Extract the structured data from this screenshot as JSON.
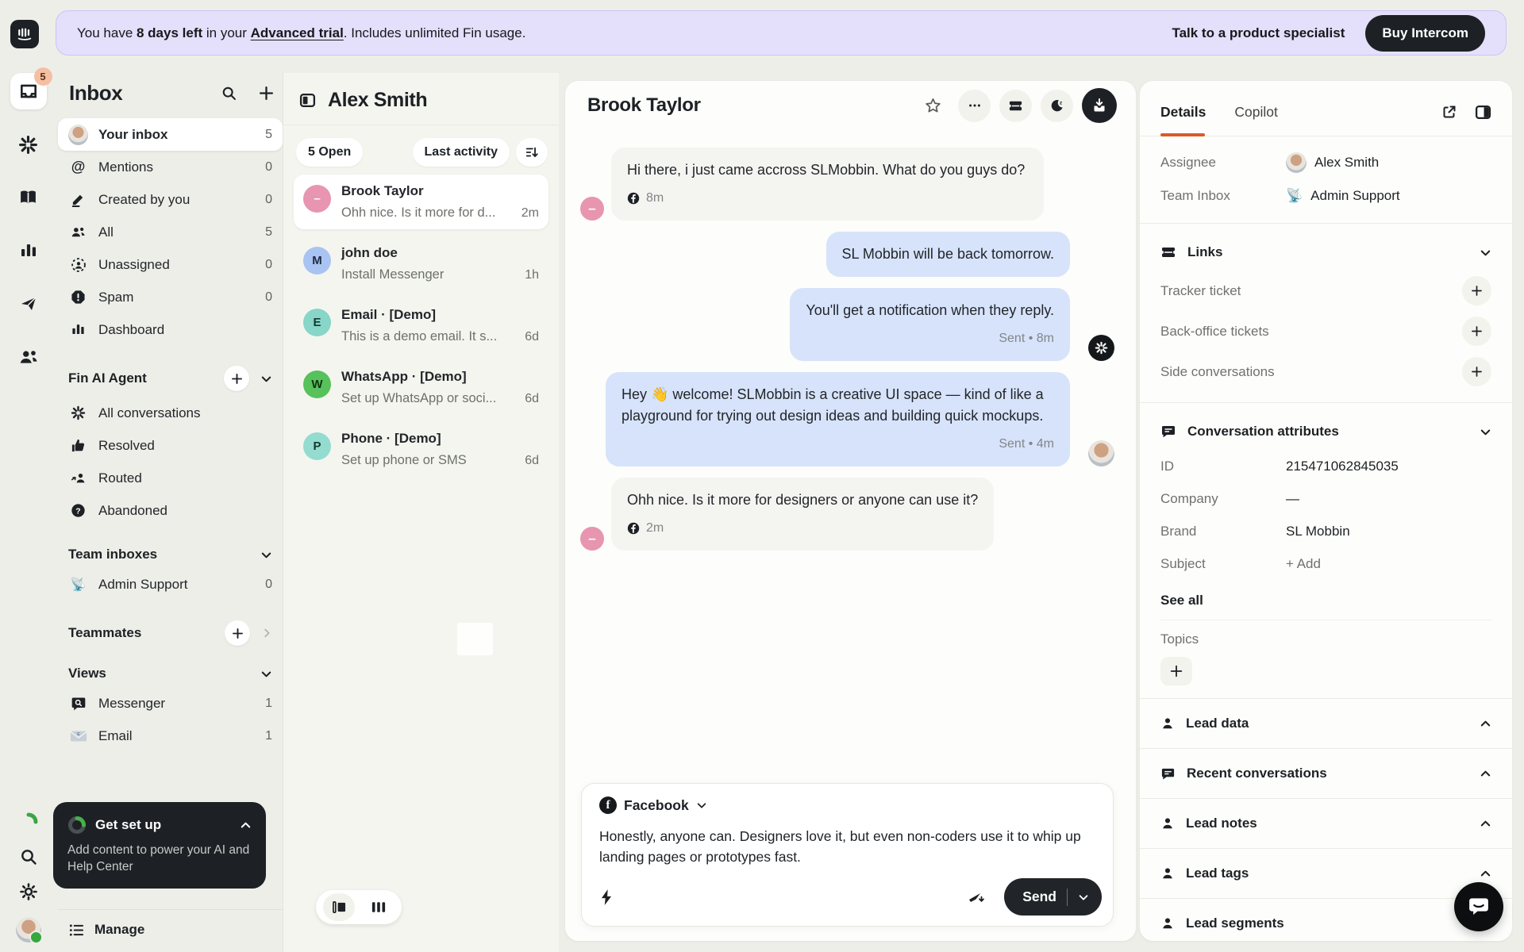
{
  "banner": {
    "message_prefix": "You have ",
    "days_left": "8 days left",
    "message_mid": " in your ",
    "trial_link": "Advanced trial",
    "message_suffix": ". Includes unlimited Fin usage.",
    "specialist_link": "Talk to a product specialist",
    "buy_button": "Buy Intercom"
  },
  "rail": {
    "inbox_badge": "5"
  },
  "sidebar": {
    "title": "Inbox",
    "items": [
      {
        "label": "Your inbox",
        "count": "5"
      },
      {
        "label": "Mentions",
        "count": "0"
      },
      {
        "label": "Created by you",
        "count": "0"
      },
      {
        "label": "All",
        "count": "5"
      },
      {
        "label": "Unassigned",
        "count": "0"
      },
      {
        "label": "Spam",
        "count": "0"
      },
      {
        "label": "Dashboard",
        "count": ""
      }
    ],
    "fin_section": {
      "title": "Fin AI Agent",
      "items": [
        "All conversations",
        "Resolved",
        "Routed",
        "Abandoned"
      ]
    },
    "team_inboxes": {
      "title": "Team inboxes",
      "items": [
        {
          "label": "Admin Support",
          "count": "0"
        }
      ]
    },
    "teammates": {
      "title": "Teammates"
    },
    "views": {
      "title": "Views",
      "items": [
        {
          "label": "Messenger",
          "count": "1"
        },
        {
          "label": "Email",
          "count": "1"
        }
      ]
    },
    "setup_card": {
      "title": "Get set up",
      "description": "Add content to power your AI and Help Center"
    },
    "manage": "Manage"
  },
  "conversation_list": {
    "header": "Alex Smith",
    "open_filter": "5 Open",
    "sort_label": "Last activity",
    "items": [
      {
        "name": "Brook Taylor",
        "preview": "Ohh nice. Is it more for d...",
        "time": "2m",
        "initial": "–"
      },
      {
        "name": "john doe",
        "preview": "Install Messenger",
        "time": "1h",
        "initial": "M"
      },
      {
        "name": "Email · [Demo]",
        "preview": "This is a demo email. It s...",
        "time": "6d",
        "initial": "E"
      },
      {
        "name": "WhatsApp · [Demo]",
        "preview": "Set up WhatsApp or soci...",
        "time": "6d",
        "initial": "W"
      },
      {
        "name": "Phone · [Demo]",
        "preview": "Set up phone or SMS",
        "time": "6d",
        "initial": "P"
      }
    ]
  },
  "chat": {
    "header": "Brook Taylor",
    "messages": [
      {
        "text": "Hi there, i just came accross SLMobbin. What do you guys do?",
        "meta": "8m"
      },
      {
        "text": "SL Mobbin will be back tomorrow.",
        "meta": ""
      },
      {
        "text": "You'll get a notification when they reply.",
        "meta": "Sent • 8m"
      },
      {
        "text": "Hey 👋 welcome! SLMobbin is a creative UI space — kind of like a playground for trying out design ideas and building quick mockups.",
        "meta": "Sent • 4m"
      },
      {
        "text": "Ohh nice. Is it more for designers or anyone can use it?",
        "meta": "2m"
      }
    ]
  },
  "composer": {
    "channel": "Facebook",
    "draft": "Honestly, anyone can. Designers love it, but even non-coders use it to whip up landing pages or prototypes fast.",
    "send_label": "Send"
  },
  "details": {
    "tabs": [
      "Details",
      "Copilot"
    ],
    "assignee_label": "Assignee",
    "assignee": "Alex Smith",
    "team_inbox_label": "Team Inbox",
    "team_inbox": "Admin Support",
    "links": {
      "title": "Links",
      "rows": [
        "Tracker ticket",
        "Back-office tickets",
        "Side conversations"
      ]
    },
    "attributes": {
      "title": "Conversation attributes",
      "rows": [
        {
          "label": "ID",
          "value": "215471062845035"
        },
        {
          "label": "Company",
          "value": "—"
        },
        {
          "label": "Brand",
          "value": "SL Mobbin"
        },
        {
          "label": "Subject",
          "value": "+ Add"
        }
      ],
      "see_all": "See all",
      "topics_label": "Topics"
    },
    "sections": [
      "Lead data",
      "Recent conversations",
      "Lead notes",
      "Lead tags",
      "Lead segments"
    ]
  },
  "colors": {
    "accent_orange": "#d85a2b",
    "banner_lavender": "#e4dffb",
    "bubble_blue": "#d6e3fa",
    "bubble_gray": "#f4f4f1",
    "dark": "#1d2125",
    "badge_salmon": "#f5bfa3"
  },
  "icons": [
    "intercom-logo",
    "inbox-icon",
    "fin-burst-icon",
    "book-icon",
    "report-icon",
    "outbound-icon",
    "contacts-icon",
    "progress-arc-icon",
    "search-icon",
    "gear-icon",
    "mention-icon",
    "pencil-icon",
    "people-icon",
    "unassigned-icon",
    "spam-icon",
    "dashboard-icon",
    "thumbs-up-icon",
    "routed-icon",
    "question-icon",
    "satellite-icon",
    "messenger-icon",
    "email-icon",
    "manage-icon",
    "collapse-panel-icon",
    "sort-icon",
    "star-icon",
    "ellipsis-icon",
    "ticket-icon",
    "snooze-icon",
    "close-conversation-icon",
    "facebook-icon",
    "lightning-icon",
    "ai-compose-icon",
    "chevron-down-icon",
    "chevron-up-icon",
    "external-link-icon",
    "side-panel-icon",
    "chat-bubble-icon",
    "person-icon",
    "plus-icon",
    "launcher-icon"
  ]
}
